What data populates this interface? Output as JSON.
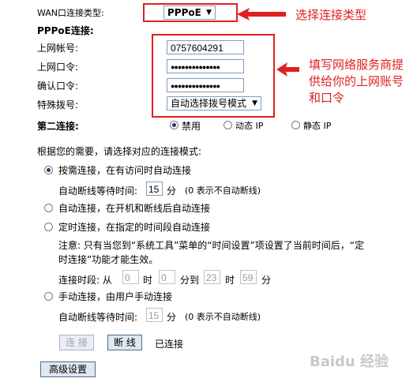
{
  "wan": {
    "type_label": "WAN口连接类型:",
    "type_value": "PPPoE",
    "pppoe_header": "PPPoE连接:",
    "account_label": "上网帐号:",
    "account_value": "0757604291",
    "password_label": "上网口令:",
    "password_value": "●●●●●●●●●●●●●●",
    "confirm_label": "确认口令:",
    "confirm_value": "●●●●●●●●●●●●●●",
    "dial_label": "特殊拨号:",
    "dial_value": "自动选择拨号模式",
    "second_label": "第二连接:",
    "second_options": [
      "禁用",
      "动态 IP",
      "静态 IP"
    ]
  },
  "mode": {
    "intro": "根据您的需要，请选择对应的连接模式:",
    "on_demand": "按需连接，在有访问时自动连接",
    "idle_label": "自动断线等待时间:",
    "idle_value": "15",
    "minute": "分",
    "idle_note": "(0 表示不自动断线)",
    "auto": "自动连接，在开机和断线后自动连接",
    "timed": "定时连接，在指定的时间段自动连接",
    "notice_line1": "注意: 只有当您到“系统工具”菜单的“时间设置”项设置了当前时间后，“定",
    "notice_line2": "时连接”功能才能生效。",
    "period_label": "连接时段: 从",
    "hour": "时",
    "to_minute": "分到",
    "from_h": "0",
    "from_m": "0",
    "to_h": "23",
    "to_m": "59",
    "manual": "手动连接，由用户手动连接",
    "manual_idle_label": "自动断线等待时间:",
    "manual_idle_value": "15",
    "manual_idle_note": "(0 表示不自动断线)"
  },
  "buttons": {
    "connect": "连 接",
    "disconnect": "断 线",
    "status": "已连接",
    "advanced": "高级设置"
  },
  "annotations": {
    "select_type": "选择连接类型",
    "fill_info_1": "填写网络服务商提",
    "fill_info_2": "供给你的上网账号",
    "fill_info_3": "和口令",
    "annotation_color": "#e02020"
  },
  "watermark": "Baidu 经验"
}
